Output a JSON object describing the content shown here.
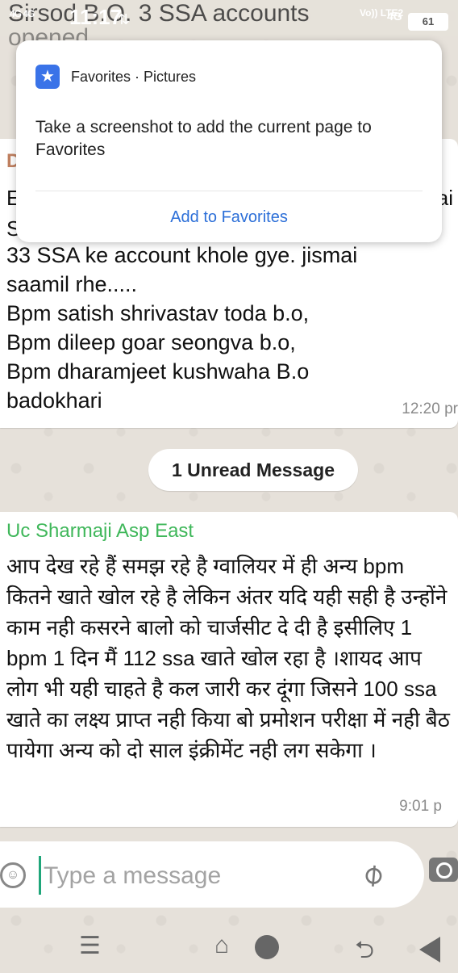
{
  "status_bar": {
    "signal": "4G 4G",
    "time": "11:17",
    "chat_title": "Sirsod B.O. 3 SSA accounts",
    "chat_title_overflow": "opened",
    "volte": "Vo)) LTE2",
    "network": "4G",
    "battery": "61"
  },
  "popup": {
    "header": "Favorites · Pictures",
    "description": "Take a screenshot to add the current page to Favorites",
    "action": "Add to Favorites",
    "accent": "#3a73e8"
  },
  "message1": {
    "frag_left_1": "D",
    "frag_left_2": "E",
    "frag_left_3": "S",
    "frag_right": "ai",
    "text": "33 SSA ke account khole gye. jismai\nsaamil rhe.....\n Bpm satish shrivastav toda b.o,\nBpm dileep goar seongva b.o,\nBpm dharamjeet kushwaha B.o\nbadokhari",
    "time": "12:20 pr"
  },
  "unread_banner": "1 Unread Message",
  "message2": {
    "sender": "Uc Sharmaji Asp East",
    "sender_color": "#3fb75a",
    "text": "आप देख रहे हैं समझ रहे है ग्वालियर में ही अन्य bpm कितने खाते खोल रहे है लेकिन अंतर यदि यही सही है उन्होंने काम नही कसरने बालो को चार्जसीट दे दी है इसीलिए 1 bpm 1 दिन मैं 112 ssa खाते खोल रहा है ।शायद आप लोग भी यही चाहते है कल जारी कर दूंगा जिसने 100 ssa खाते का लक्ष्य प्राप्त नही किया बो प्रमोशन परीक्षा में नही बैठ पायेगा अन्य को दो साल इंक्रीमेंट नही लग सकेगा ।",
    "time": "9:01 p"
  },
  "input": {
    "placeholder": "Type a message",
    "emoji_icon": "emoji-icon",
    "attach_icon": "paperclip-icon",
    "camera_icon": "camera-icon"
  },
  "nav": {
    "menu": "☰",
    "home": "⌂",
    "recent": "⮌"
  }
}
